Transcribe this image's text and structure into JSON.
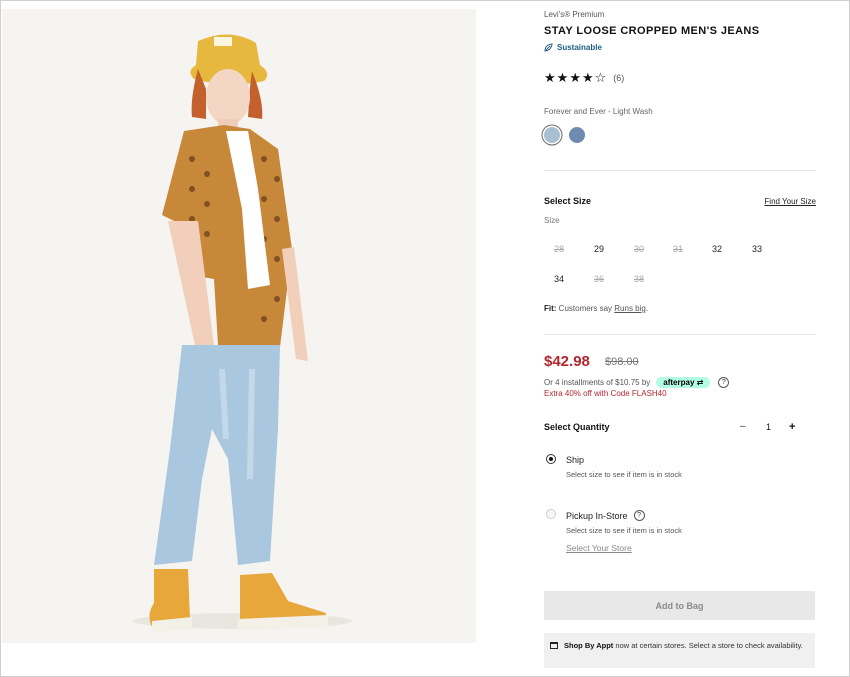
{
  "product": {
    "brand": "Levi's® Premium",
    "title": "STAY LOOSE CROPPED MEN'S JEANS",
    "sustainable_label": "Sustainable",
    "rating_stars": 4,
    "rating_max": 5,
    "review_count": "(6)",
    "color_name": "Forever and Ever - Light Wash",
    "swatches": [
      {
        "name": "Forever and Ever - Light Wash",
        "color": "#a8bfd1",
        "selected": true
      },
      {
        "name": "medium wash",
        "color": "#6f8cb0",
        "selected": false
      }
    ]
  },
  "size": {
    "heading": "Select Size",
    "find_link": "Find Your Size",
    "caption": "Size",
    "options": [
      {
        "label": "28",
        "available": false
      },
      {
        "label": "29",
        "available": true
      },
      {
        "label": "30",
        "available": false
      },
      {
        "label": "31",
        "available": false
      },
      {
        "label": "32",
        "available": true
      },
      {
        "label": "33",
        "available": true
      },
      {
        "label": "34",
        "available": true
      },
      {
        "label": "36",
        "available": false
      },
      {
        "label": "38",
        "available": false
      }
    ],
    "fit_label": "Fit:",
    "fit_text": "Customers say",
    "fit_link": "Runs big",
    "fit_end": "."
  },
  "pricing": {
    "price": "$42.98",
    "old_price": "$98.00",
    "installments": "Or 4 installments of $10.75 by",
    "afterpay": "afterpay",
    "help": "?",
    "promo": "Extra 40% off with Code FLASH40"
  },
  "quantity": {
    "label": "Select Quantity",
    "minus": "–",
    "value": "1",
    "plus": "+"
  },
  "fulfillment": {
    "ship_label": "Ship",
    "ship_sub": "Select size to see if item is in stock",
    "pickup_label": "Pickup In-Store",
    "pickup_help": "?",
    "pickup_sub": "Select size to see if item is in stock",
    "store_link": "Select Your Store"
  },
  "add_to_bag": "Add to Bag",
  "appointment": {
    "bold": "Shop By Appt",
    "text": " now at certain stores. Select a store to check availability."
  },
  "colors": {
    "price_red": "#b2262e",
    "sustainable_blue": "#1d5e82",
    "afterpay_mint": "#b2fce4"
  }
}
